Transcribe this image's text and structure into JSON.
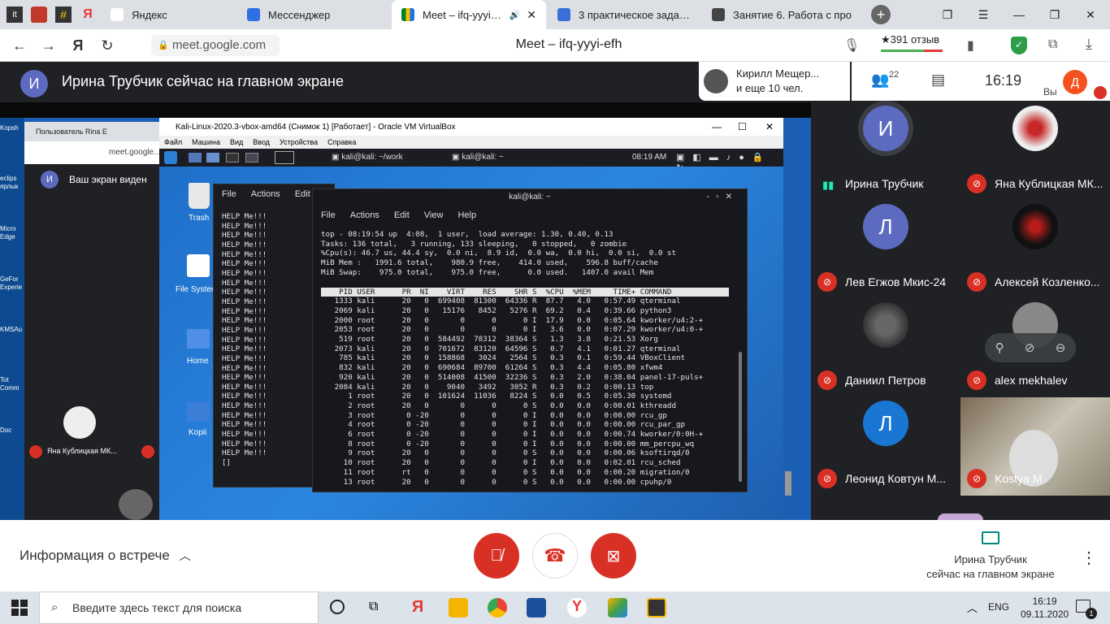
{
  "browser": {
    "tabs": [
      {
        "label": "Яндекс",
        "active": false
      },
      {
        "label": "Мессенджер",
        "active": false
      },
      {
        "label": "Meet – ifq-yyyi-efh",
        "active": true
      },
      {
        "label": "3 практическое задание",
        "active": false
      },
      {
        "label": "Занятие 6. Работа с про",
        "active": false
      }
    ],
    "url": "meet.google.com",
    "page_title": "Meet – ifq-yyyi-efh",
    "rating": "★391 отзыв"
  },
  "meet": {
    "presenter_initial": "И",
    "presenter_text": "Ирина Трубчик сейчас на главном экране",
    "people_card": {
      "line1": "Кирилл Мещер...",
      "line2": "и еще 10 чел."
    },
    "participants_count": "22",
    "time": "16:19",
    "self_label": "Вы",
    "self_initial": "Д",
    "meeting_info": "Информация о встрече",
    "now_presenting_line1": "Ирина Трубчик",
    "now_presenting_line2": "сейчас на главном экране",
    "colors": {
      "red": "#d93025",
      "accent": "#1a73e8",
      "bg": "#202124"
    }
  },
  "participants": [
    {
      "name": "Ирина Трубчик",
      "initial": "И",
      "color": "#5c6bc0",
      "muted": false
    },
    {
      "name": "Яна Кублицкая МК...",
      "initial": "",
      "color": "#eee",
      "muted": true
    },
    {
      "name": "Лев Егжов Мкис-24",
      "initial": "Л",
      "color": "#5c6bc0",
      "muted": true
    },
    {
      "name": "Алексей Козленко...",
      "initial": "",
      "color": "#111",
      "muted": true
    },
    {
      "name": "Даниил Петров",
      "initial": "",
      "color": "#555",
      "muted": true
    },
    {
      "name": "alex mekhalev",
      "initial": "",
      "color": "#777",
      "muted": true
    },
    {
      "name": "Леонид Ковтун М...",
      "initial": "Л",
      "color": "#1976d2",
      "muted": true
    },
    {
      "name": "Kostya M",
      "initial": "",
      "color": "#998",
      "muted": true
    }
  ],
  "vbox": {
    "title": "Kali-Linux-2020.3-vbox-amd64 (Снимок 1) [Работает] - Oracle VM VirtualBox",
    "menu": [
      "Файл",
      "Машина",
      "Вид",
      "Ввод",
      "Устройства",
      "Справка"
    ]
  },
  "kali": {
    "panel_tab1": "kali@kali: ~/work",
    "panel_tab2": "kali@kali: ~",
    "panel_time": "08:19 AM",
    "desktop_icons": [
      "Trash",
      "File System",
      "Home",
      "Kopii"
    ],
    "term1_menu": [
      "File",
      "Actions",
      "Edit"
    ],
    "term1_text": "HELP Me!!!\nHELP Me!!!\nHELP Me!!!\nHELP Me!!!\nHELP Me!!!\nHELP Me!!!\nHELP Me!!!\nHELP Me!!!\nHELP Me!!!\nHELP Me!!!\nHELP Me!!!\nHELP Me!!!\nHELP Me!!!\nHELP Me!!!\nHELP Me!!!\nHELP Me!!!\nHELP Me!!!\nHELP Me!!!\nHELP Me!!!\nHELP Me!!!\nHELP Me!!!\nHELP Me!!!\nHELP Me!!!\nHELP Me!!!\nHELP Me!!!\nHELP Me!!!\n[]",
    "term2_title": "kali@kali: ~",
    "term2_menu": [
      "File",
      "Actions",
      "Edit",
      "View",
      "Help"
    ],
    "top_header": "top - 08:19:54 up  4:08,  1 user,  load average: 1.30, 0.40, 0.13\nTasks: 136 total,   3 running, 133 sleeping,   0 stopped,   0 zombie\n%Cpu(s): 46.7 us, 44.4 sy,  0.0 ni,  8.9 id,  0.0 wa,  0.0 hi,  0.0 si,  0.0 st\nMiB Mem :   1991.6 total,    980.9 free,    414.0 used,    596.8 buff/cache\nMiB Swap:    975.0 total,    975.0 free,      0.0 used.   1407.0 avail Mem",
    "top_columns": "    PID USER      PR  NI    VIRT    RES    SHR S  %CPU  %MEM     TIME+ COMMAND      ",
    "top_rows": "   1333 kali      20   0  699408  81300  64336 R  87.7   4.0   0:57.49 qterminal\n   2069 kali      20   0   15176   8452   5276 R  69.2   0.4   0:39.66 python3\n   2000 root      20   0       0      0      0 I  17.9   0.0   0:05.64 kworker/u4:2-+\n   2053 root      20   0       0      0      0 I   3.6   0.0   0:07.29 kworker/u4:0-+\n    519 root      20   0  584492  78312  38364 S   1.3   3.8   0:21.53 Xorg\n   2073 kali      20   0  701672  83120  64596 S   0.7   4.1   0:01.27 qterminal\n    785 kali      20   0  158868   3024   2564 S   0.3   0.1   0:59.44 VBoxClient\n    832 kali      20   0  690684  89700  61264 S   0.3   4.4   0:05.80 xfwm4\n    920 kali      20   0  514008  41500  32236 S   0.3   2.0   0:38.04 panel-17-puls+\n   2084 kali      20   0    9040   3492   3052 R   0.3   0.2   0:00.13 top\n      1 root      20   0  101624  11036   8224 S   0.0   0.5   0:05.30 systemd\n      2 root      20   0       0      0      0 S   0.0   0.0   0:00.01 kthreadd\n      3 root       0 -20       0      0      0 I   0.0   0.0   0:00.00 rcu_gp\n      4 root       0 -20       0      0      0 I   0.0   0.0   0:00.00 rcu_par_gp\n      6 root       0 -20       0      0      0 I   0.0   0.0   0:00.74 kworker/0:0H-+\n      8 root       0 -20       0      0      0 I   0.0   0.0   0:00.00 mm_percpu_wq\n      9 root      20   0       0      0      0 S   0.0   0.0   0:00.06 ksoftirqd/0\n     10 root      20   0       0      0      0 I   0.0   0.0   0:02.01 rcu_sched\n     11 root      rt   0       0      0      0 S   0.0   0.0   0:00.20 migration/0\n     13 root      20   0       0      0      0 S   0.0   0.0   0:00.00 cpuhp/0"
  },
  "inner": {
    "tab_label": "Пользователь Rina E",
    "url": "meet.google...",
    "banner": "Ваш экран виден",
    "participant": "Яна Кублицкая МК...",
    "desktop_icons": [
      "Kopsh",
      "eclips ярлык",
      "Micro Edge",
      "GeFor Experie",
      "KMSAu",
      "Tot Comm",
      "Doc"
    ]
  },
  "taskbar": {
    "search_placeholder": "Введите здесь текст для поиска",
    "lang": "ENG",
    "time": "16:19",
    "date": "09.11.2020",
    "notif": "1"
  }
}
